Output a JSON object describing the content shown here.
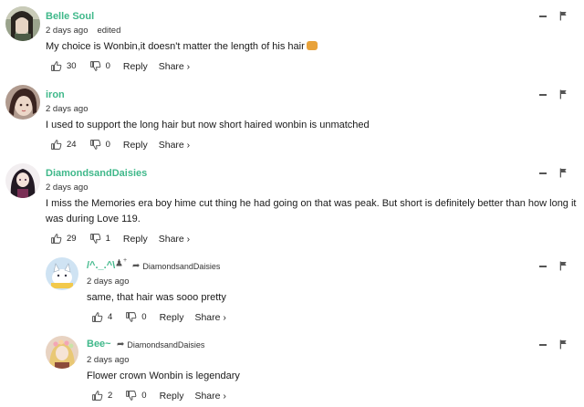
{
  "comments": [
    {
      "username": "Belle Soul",
      "time": "2 days ago",
      "edited": "edited",
      "text": "My choice is Wonbin,it doesn't matter the length of his hair",
      "likes": "30",
      "dislikes": "0",
      "reply_label": "Reply",
      "share_label": "Share ›"
    },
    {
      "username": "iron",
      "time": "2 days ago",
      "text": "I used to support the long hair but now short haired wonbin is unmatched",
      "likes": "24",
      "dislikes": "0",
      "reply_label": "Reply",
      "share_label": "Share ›"
    },
    {
      "username": "DiamondsandDaisies",
      "time": "2 days ago",
      "text_line1": "I miss the Memories era boy hime cut thing he had going on that was peak. But short is definitely better than how long it",
      "text_line2": "was during Love 119.",
      "likes": "29",
      "dislikes": "1",
      "reply_label": "Reply",
      "share_label": "Share ›"
    },
    {
      "username": "/^._.^\\",
      "reply_to": "DiamondsandDaisies",
      "time": "2 days ago",
      "text": "same, that hair was sooo pretty",
      "likes": "4",
      "dislikes": "0",
      "reply_label": "Reply",
      "share_label": "Share ›"
    },
    {
      "username": "Bee~",
      "reply_to": "DiamondsandDaisies",
      "time": "2 days ago",
      "text": "Flower crown Wonbin is legendary",
      "likes": "2",
      "dislikes": "0",
      "reply_label": "Reply",
      "share_label": "Share ›"
    }
  ],
  "icons": {
    "upvote": "thumbs-up-icon",
    "downvote": "thumbs-down-icon",
    "collapse": "minus-icon",
    "flag": "flag-icon",
    "reply_arrow": "reply-arrow-icon",
    "follow": "add-person-icon"
  },
  "colors": {
    "username": "#3fb88a"
  }
}
